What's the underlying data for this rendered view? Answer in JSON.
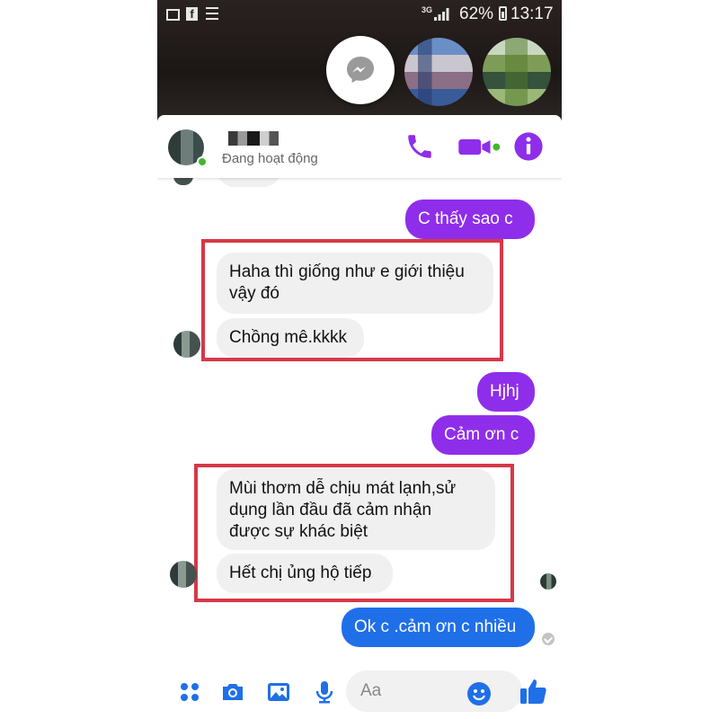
{
  "status_bar": {
    "network": "3G",
    "battery_percent": "62%",
    "time": "13:17",
    "icons": [
      "gallery-icon",
      "facebook-icon",
      "list-icon",
      "signal-icon",
      "battery-icon"
    ]
  },
  "chat_heads": [
    "messenger-icon",
    "contact-avatar",
    "contact-avatar"
  ],
  "header": {
    "status": "Đang hoạt động",
    "icons": [
      "phone-icon",
      "video-icon",
      "info-icon"
    ]
  },
  "messages": [
    {
      "direction": "outgoing",
      "text": "C thấy sao  c"
    },
    {
      "direction": "incoming",
      "text": "Haha thì giống như e giới thiệu\nvậy đó"
    },
    {
      "direction": "incoming",
      "text": "Chồng mê.kkkk"
    },
    {
      "direction": "outgoing",
      "text": "Hjhj"
    },
    {
      "direction": "outgoing",
      "text": "Cảm ơn c"
    },
    {
      "direction": "incoming",
      "text": "Mùi thơm dễ chịu mát lạnh,sử\ndụng lần đầu đã cảm nhận\nđược sự khác biệt"
    },
    {
      "direction": "incoming",
      "text": "Hết chị ủng hộ tiếp"
    },
    {
      "direction": "outgoing",
      "text": "Ok c .cảm ơn c nhiều"
    }
  ],
  "composer": {
    "placeholder": "Aa",
    "icons": [
      "apps-icon",
      "camera-icon",
      "image-icon",
      "microphone-icon",
      "emoji-icon",
      "thumbs-up-icon"
    ]
  },
  "colors": {
    "accent_purple": "#8f2eea",
    "accent_blue": "#1f6fe8",
    "online_green": "#42b72a",
    "highlight_red": "#d63848"
  }
}
